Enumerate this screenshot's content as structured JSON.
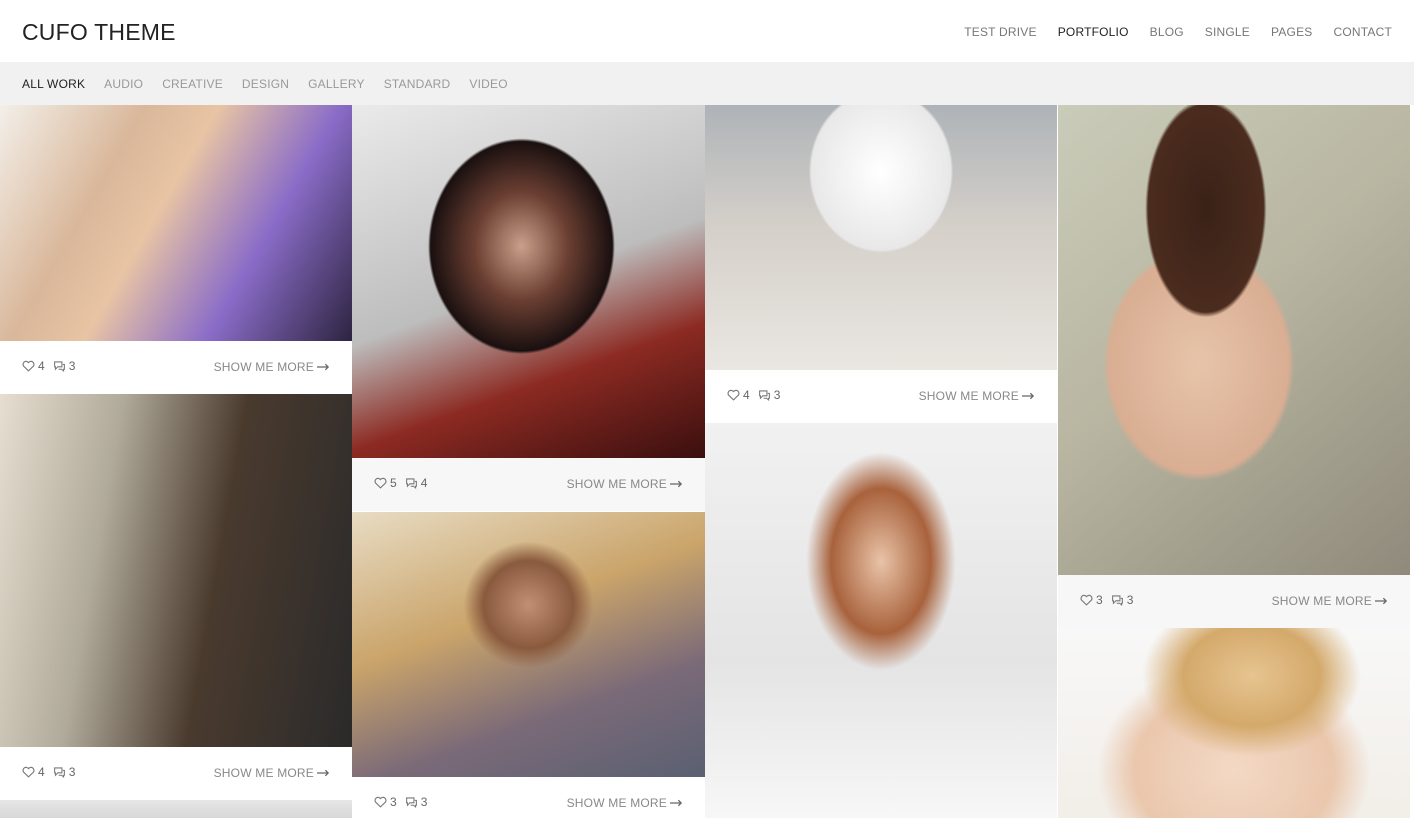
{
  "site": {
    "logo": "CUFO THEME"
  },
  "nav": {
    "items": [
      {
        "label": "TEST DRIVE",
        "active": false
      },
      {
        "label": "PORTFOLIO",
        "active": true
      },
      {
        "label": "BLOG",
        "active": false
      },
      {
        "label": "SINGLE",
        "active": false
      },
      {
        "label": "PAGES",
        "active": false
      },
      {
        "label": "CONTACT",
        "active": false
      }
    ]
  },
  "filters": {
    "items": [
      {
        "label": "ALL WORK",
        "active": true
      },
      {
        "label": "AUDIO",
        "active": false
      },
      {
        "label": "CREATIVE",
        "active": false
      },
      {
        "label": "DESIGN",
        "active": false
      },
      {
        "label": "GALLERY",
        "active": false
      },
      {
        "label": "STANDARD",
        "active": false
      },
      {
        "label": "VIDEO",
        "active": false
      }
    ]
  },
  "cards": [
    {
      "likes": "4",
      "comments": "3",
      "more": "SHOW ME MORE"
    },
    {
      "likes": "5",
      "comments": "4",
      "more": "SHOW ME MORE"
    },
    {
      "likes": "4",
      "comments": "3",
      "more": "SHOW ME MORE"
    },
    {
      "likes": "3",
      "comments": "3",
      "more": "SHOW ME MORE"
    },
    {
      "likes": "4",
      "comments": "3",
      "more": "SHOW ME MORE"
    },
    {
      "likes": "3",
      "comments": "3",
      "more": "SHOW ME MORE"
    }
  ],
  "icons": {
    "like": "heart-icon",
    "comment": "comment-icon",
    "arrow": "arrow-right-icon"
  }
}
